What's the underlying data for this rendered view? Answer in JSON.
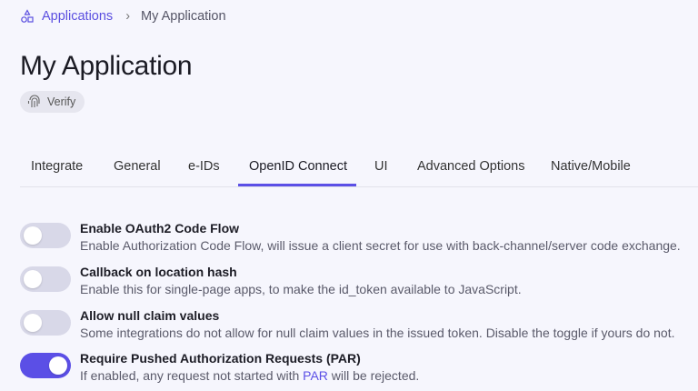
{
  "breadcrumb": {
    "root": "Applications",
    "current": "My Application"
  },
  "page": {
    "title": "My Application",
    "badge": "Verify"
  },
  "tabs": [
    {
      "label": "Integrate"
    },
    {
      "label": "General"
    },
    {
      "label": "e-IDs"
    },
    {
      "label": "OpenID Connect",
      "active": true
    },
    {
      "label": "UI"
    },
    {
      "label": "Advanced Options"
    },
    {
      "label": "Native/Mobile"
    }
  ],
  "settings": [
    {
      "title": "Enable OAuth2 Code Flow",
      "description": "Enable Authorization Code Flow, will issue a client secret for use with back-channel/server code exchange.",
      "enabled": false
    },
    {
      "title": "Callback on location hash",
      "description": "Enable this for single-page apps, to make the id_token available to JavaScript.",
      "enabled": false
    },
    {
      "title": "Allow null claim values",
      "description": "Some integrations do not allow for null claim values in the issued token. Disable the toggle if yours do not.",
      "enabled": false
    },
    {
      "title": "Require Pushed Authorization Requests (PAR)",
      "description_pre": "If enabled, any request not started with ",
      "description_link": "PAR",
      "description_post": " will be rejected.",
      "enabled": true
    }
  ],
  "colors": {
    "accent": "#5b4fe6",
    "background": "#f6f6fd"
  }
}
